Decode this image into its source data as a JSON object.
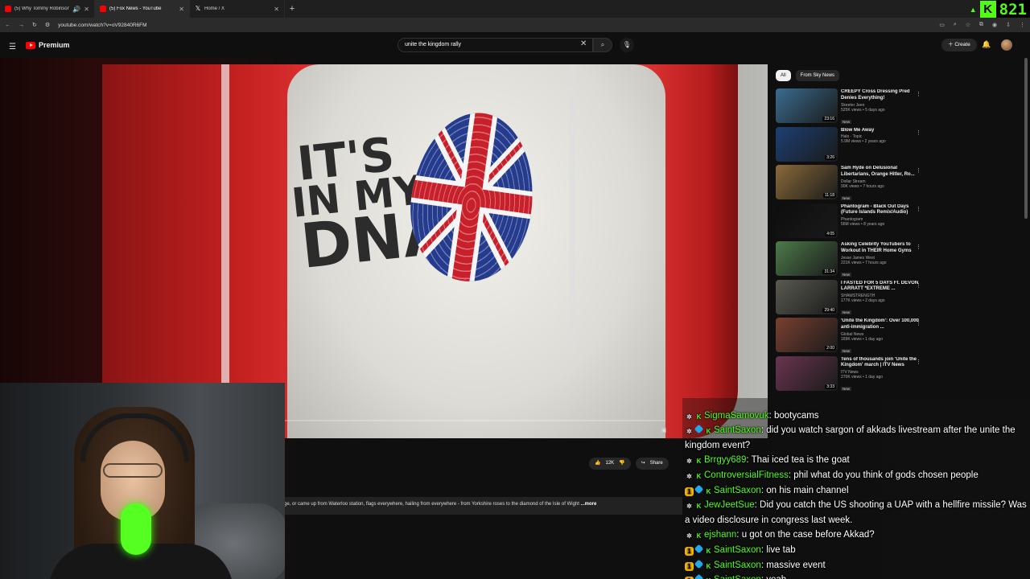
{
  "browser": {
    "tabs": [
      {
        "title": "(5) Why Tommy Robinson c",
        "active": false,
        "icon": "youtube-icon"
      },
      {
        "title": "(5) Fox News - YouTube",
        "active": true,
        "icon": "youtube-icon"
      },
      {
        "title": "Home / X",
        "active": false,
        "icon": "x-icon"
      }
    ],
    "url": "youtube.com/watch?v=oV92840R6FM",
    "kick_count": "821"
  },
  "youtube": {
    "logo_text": "Premium",
    "search_value": "unite the kingdom rally",
    "create_label": "Create"
  },
  "video": {
    "shirt_line1": "IT'S",
    "shirt_line2": "IN MY",
    "shirt_line3": "DNA",
    "likes": "12K",
    "share_label": "Share",
    "description": "ge, or came up from Waterloo station, flags everywhere, hailing from everywhere - from Yorkshire roses to the diamond of the Isle of Wight",
    "more_label": "...more"
  },
  "sidebar": {
    "chips": [
      {
        "label": "All",
        "active": true
      },
      {
        "label": "From Sky News",
        "active": false
      }
    ],
    "recommendations": [
      {
        "title": "CREEPY Cross Dressing Pred Denies Everything!",
        "channel": "Skeeter Jeen",
        "views": "525K views • 5 days ago",
        "badge": "New",
        "duration": "23:16",
        "thumb": "#3a6c8f"
      },
      {
        "title": "Blow Me Away",
        "channel": "Halo - Topic",
        "views": "5.9M views • 2 years ago",
        "badge": "",
        "duration": "3:26",
        "thumb": "#1c3f73"
      },
      {
        "title": "Sam Hyde on Delusional Libertarians, Orange Hitler, Ro...",
        "channel": "Dollar Stream",
        "views": "90K views • 7 hours ago",
        "badge": "New",
        "duration": "11:18",
        "thumb": "#8a6a3a"
      },
      {
        "title": "Phantogram - Black Out Days (Future Islands Remix/Audio)",
        "channel": "Phantogram",
        "views": "56M views • 8 years ago",
        "badge": "",
        "duration": "4:05",
        "thumb": "#0d0d0d"
      },
      {
        "title": "Asking Celebrity YouTubers to Workout in THEIR Home Gyms",
        "channel": "Jesse James West",
        "views": "221K views • 7 hours ago",
        "badge": "New",
        "duration": "31:34",
        "thumb": "#4d7a4a"
      },
      {
        "title": "I FASTED FOR 5 DAYS Ft. DEVON LARRATT *EXTREME ...",
        "channel": "SHAWSTRENGTH",
        "views": "177K views • 2 days ago",
        "badge": "New",
        "duration": "29:40",
        "thumb": "#5a5a52"
      },
      {
        "title": "'Unite the Kingdom': Over 100,000 anti-immigration ...",
        "channel": "Global News",
        "views": "169K views • 1 day ago",
        "badge": "New",
        "duration": "2:00",
        "thumb": "#7a4030"
      },
      {
        "title": "Tens of thousands join 'Unite the Kingdom' march | ITV News",
        "channel": "ITV News",
        "views": "270K views • 1 day ago",
        "badge": "New",
        "duration": "3:33",
        "thumb": "#6a3550"
      }
    ]
  },
  "chat": {
    "messages": [
      {
        "badges": [
          "star",
          "k"
        ],
        "user": "SigmaSamovuk",
        "text": "bootycams"
      },
      {
        "badges": [
          "star",
          "gem",
          "k"
        ],
        "user": "SaintSaxon",
        "text": "did you watch sargon of akkads livestream after the unite the kingdom event?"
      },
      {
        "badges": [
          "star",
          "k"
        ],
        "user": "Brrgyy689",
        "text": "Thai iced tea is the goat"
      },
      {
        "badges": [
          "star",
          "k"
        ],
        "user": "ControversialFitness",
        "text": "phil what do you think of gods chosen people"
      },
      {
        "badges": [
          "one",
          "gem",
          "k"
        ],
        "user": "SaintSaxon",
        "text": "on his main channel"
      },
      {
        "badges": [
          "star",
          "k"
        ],
        "user": "JewJeetSue",
        "text": "Did you catch the US shooting a UAP with a hellfire missile? Was a video disclosure in congress last week."
      },
      {
        "badges": [
          "star",
          "k"
        ],
        "user": "ejshann",
        "text": "u got on the case before Akkad?"
      },
      {
        "badges": [
          "one",
          "gem",
          "k"
        ],
        "user": "SaintSaxon",
        "text": "live tab"
      },
      {
        "badges": [
          "one",
          "gem",
          "k"
        ],
        "user": "SaintSaxon",
        "text": "massive event"
      },
      {
        "badges": [
          "one",
          "gem",
          "k"
        ],
        "user": "SaintSaxon",
        "text": "yeah"
      }
    ]
  },
  "colors": {
    "kick_green": "#53fc18",
    "youtube_red": "#ff0000"
  }
}
